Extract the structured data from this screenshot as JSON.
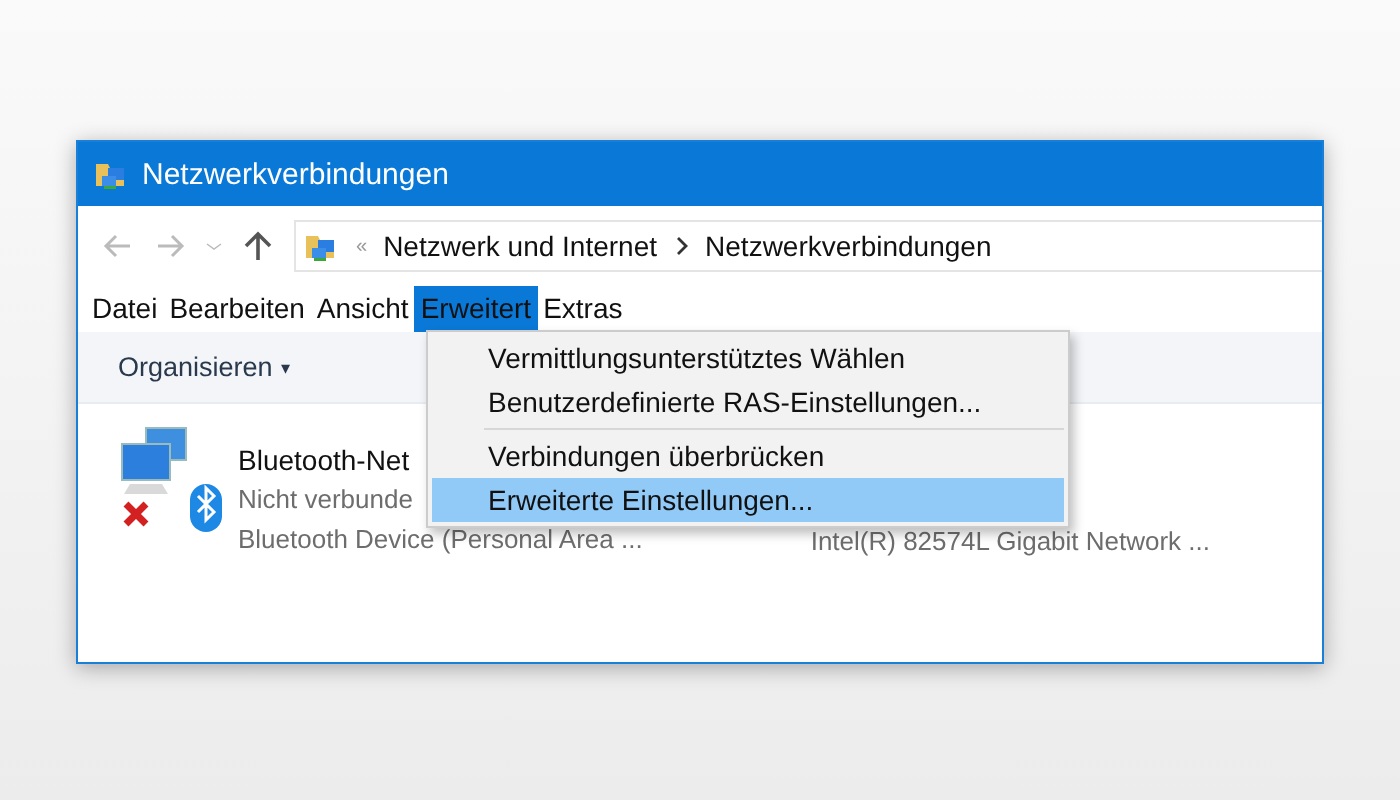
{
  "window": {
    "title": "Netzwerkverbindungen"
  },
  "address": {
    "separator": "«",
    "crumbs": [
      "Netzwerk und Internet",
      "Netzwerkverbindungen"
    ]
  },
  "menubar": [
    {
      "label": "Datei",
      "selected": false
    },
    {
      "label": "Bearbeiten",
      "selected": false
    },
    {
      "label": "Ansicht",
      "selected": false
    },
    {
      "label": "Erweitert",
      "selected": true
    },
    {
      "label": "Extras",
      "selected": false
    }
  ],
  "commandbar": {
    "organize": "Organisieren",
    "caret": "▾"
  },
  "connections": [
    {
      "name": "Bluetooth-Net",
      "status": "Nicht verbunde",
      "device": "Bluetooth Device (Personal Area ..."
    },
    {
      "device": "Intel(R) 82574L Gigabit Network ..."
    }
  ],
  "menu": [
    {
      "kind": "item",
      "label": "Vermittlungsunterstütztes Wählen",
      "selected": false
    },
    {
      "kind": "item",
      "label": "Benutzerdefinierte RAS-Einstellungen...",
      "selected": false
    },
    {
      "kind": "separator"
    },
    {
      "kind": "item",
      "label": "Verbindungen überbrücken",
      "selected": false
    },
    {
      "kind": "item",
      "label": "Erweiterte Einstellungen...",
      "selected": true
    }
  ]
}
